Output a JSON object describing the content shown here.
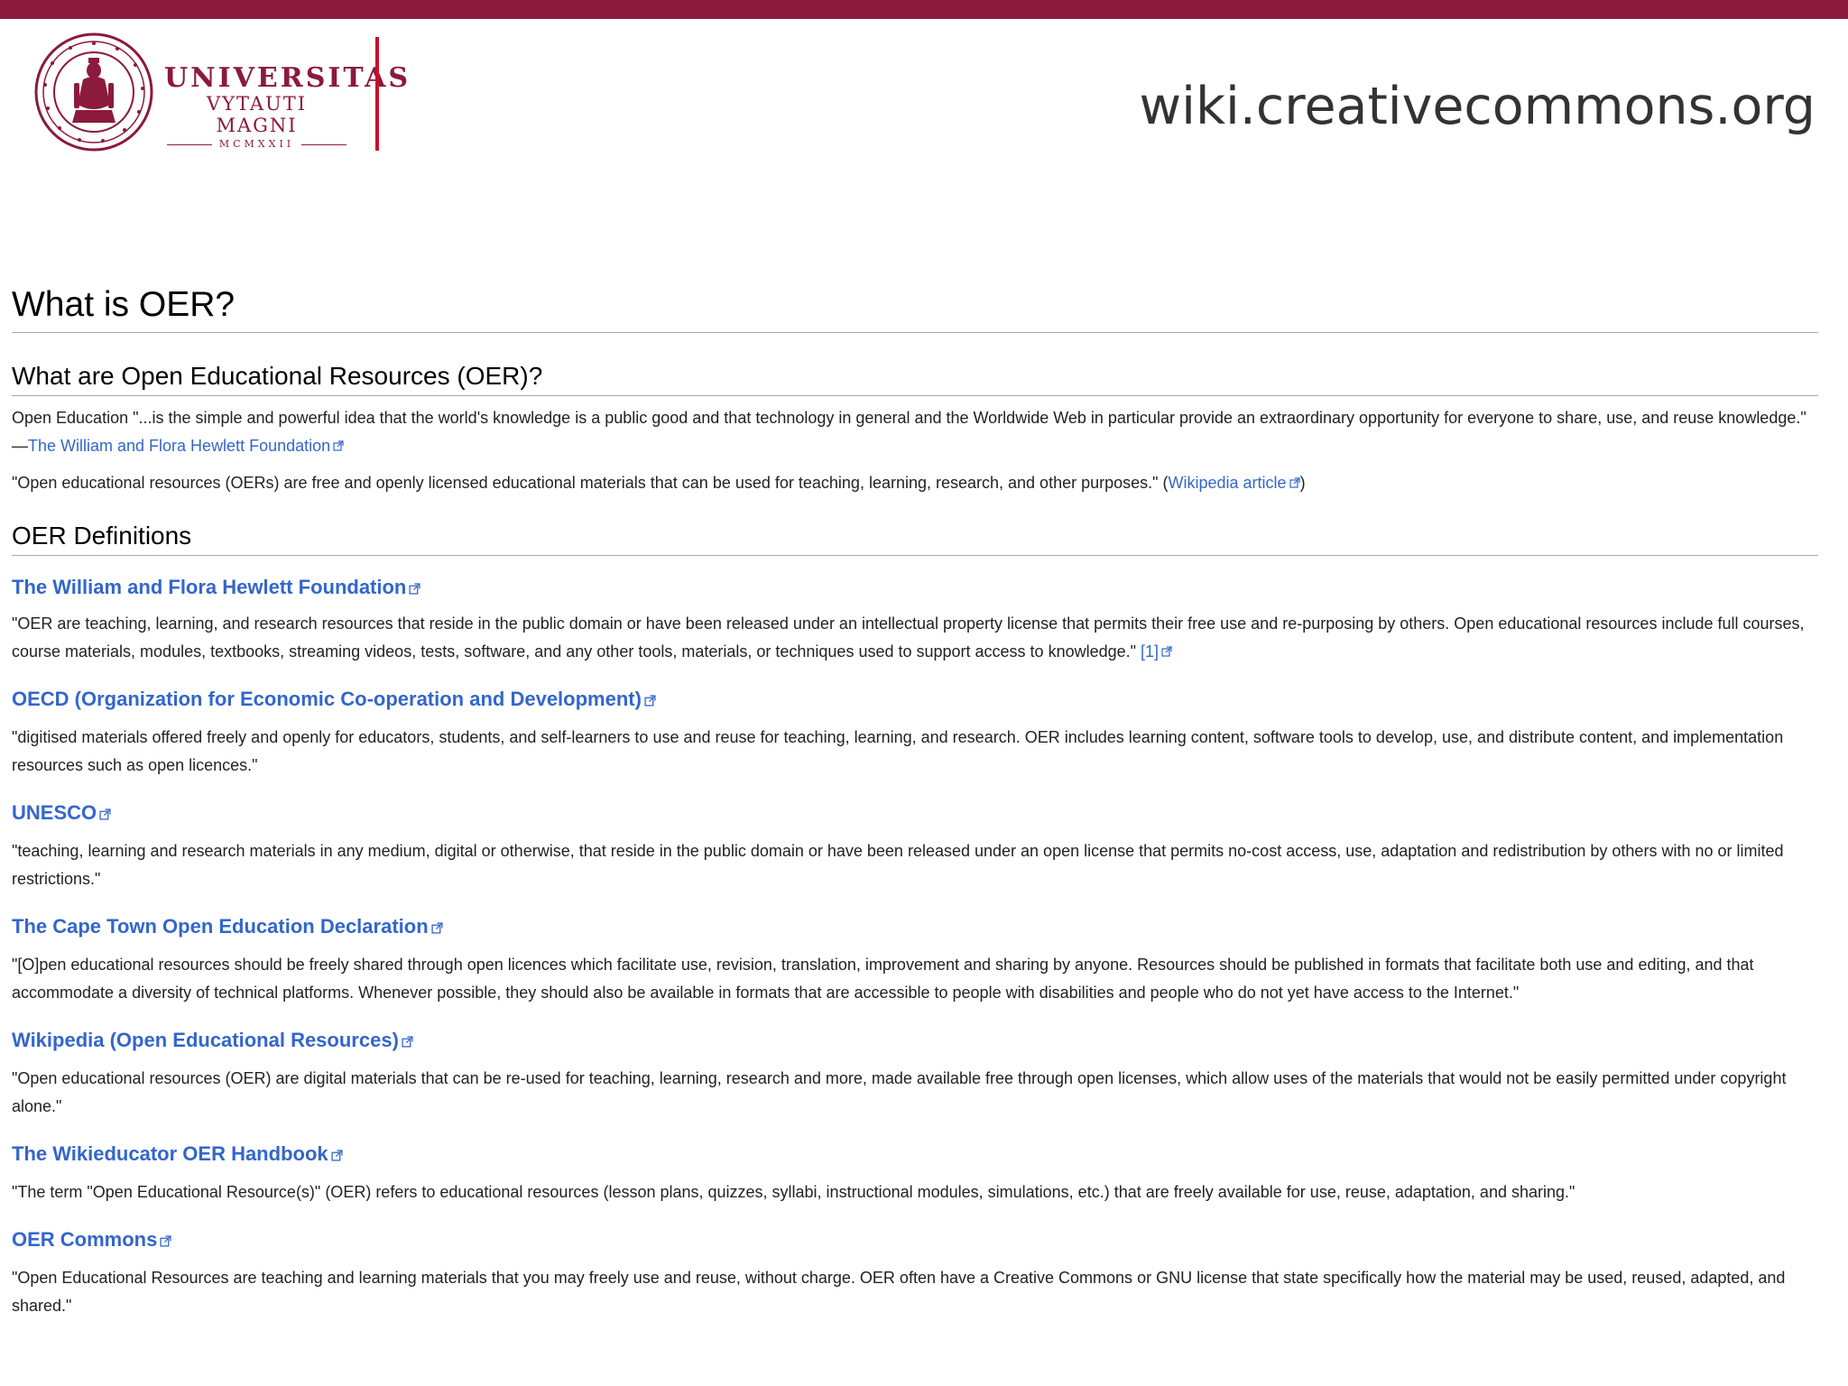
{
  "header": {
    "logo_line1": "UNIVERSITAS",
    "logo_line2": "VYTAUTI MAGNI",
    "logo_line3": "MCMXXII",
    "site_url": "wiki.creativecommons.org",
    "colors": {
      "brand": "#8b1a3c",
      "divider": "#c8102e"
    }
  },
  "article": {
    "title": "What is OER?",
    "section1": {
      "heading": "What are Open Educational Resources (OER)?",
      "quote": "Open Education \"...is the simple and powerful idea that the world's knowledge is a public good and that technology in general and the Worldwide Web in particular provide an extraordinary opportunity for everyone to share, use, and reuse knowledge.\"",
      "attribution_dash": "—",
      "attribution_link": "The William and Flora Hewlett Foundation",
      "wiki_text": "\"Open educational resources (OERs) are free and openly licensed educational materials that can be used for teaching, learning, research, and other purposes.\" (",
      "wiki_link": "Wikipedia article",
      "wiki_close": ")"
    },
    "section2": {
      "heading": "OER Definitions",
      "definitions": [
        {
          "title": "The William and Flora Hewlett Foundation",
          "text": "\"OER are teaching, learning, and research resources that reside in the public domain or have been released under an intellectual property license that permits their free use and re-purposing by others. Open educational resources include full courses, course materials, modules, textbooks, streaming videos, tests, software, and any other tools, materials, or techniques used to support access to knowledge.\"",
          "ref": "[1]"
        },
        {
          "title": "OECD (Organization for Economic Co-operation and Development)",
          "text": "\"digitised materials offered freely and openly for educators, students, and self-learners to use and reuse for teaching, learning, and research. OER includes learning content, software tools to develop, use, and distribute content, and implementation resources such as open licences.\""
        },
        {
          "title": "UNESCO",
          "text": "\"teaching, learning and research materials in any medium, digital or otherwise, that reside in the public domain or have been released under an open license that permits no-cost access, use, adaptation and redistribution by others with no or limited restrictions.\""
        },
        {
          "title": "The Cape Town Open Education Declaration",
          "text": "\"[O]pen educational resources should be freely shared through open licences which facilitate use, revision, translation, improvement and sharing by anyone. Resources should be published in formats that facilitate both use and editing, and that accommodate a diversity of technical platforms. Whenever possible, they should also be available in formats that are accessible to people with disabilities and people who do not yet have access to the Internet.\""
        },
        {
          "title": "Wikipedia (Open Educational Resources)",
          "text": "\"Open educational resources (OER) are digital materials that can be re-used for teaching, learning, research and more, made available free through open licenses, which allow uses of the materials that would not be easily permitted under copyright alone.\""
        },
        {
          "title": "The Wikieducator OER Handbook",
          "text": "\"The term \"Open Educational Resource(s)\" (OER) refers to educational resources (lesson plans, quizzes, syllabi, instructional modules, simulations, etc.) that are freely available for use, reuse, adaptation, and sharing.\""
        },
        {
          "title": "OER Commons",
          "text": "\"Open Educational Resources are teaching and learning materials that you may freely use and reuse, without charge. OER often have a Creative Commons or GNU license that state specifically how the material may be used, reused, adapted, and shared.\""
        }
      ]
    },
    "colors": {
      "link": "#3366cc",
      "text": "#222222"
    }
  }
}
